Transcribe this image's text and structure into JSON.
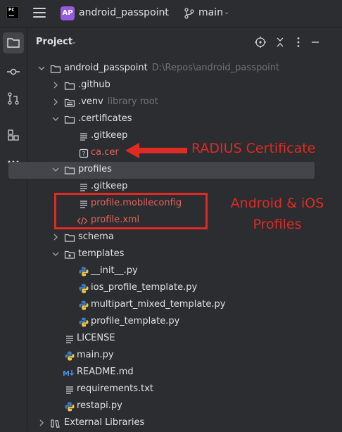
{
  "titlebar": {
    "logo_text": "PC",
    "project_badge": "AP",
    "project_name": "android_passpoint",
    "branch": "main"
  },
  "panel": {
    "title": "Project"
  },
  "tree": {
    "root": {
      "name": "android_passpoint",
      "path": "D:\\Repos\\android_passpoint"
    },
    "github": ".github",
    "venv": ".venv",
    "venv_hint": "library root",
    "certificates": ".certificates",
    "cert_gitkeep": ".gitkeep",
    "ca_cer": "ca.cer",
    "profiles": "profiles",
    "profiles_gitkeep": ".gitkeep",
    "mobileconfig": "profile.mobileconfig",
    "profile_xml": "profile.xml",
    "schema": "schema",
    "templates": "templates",
    "init_py": "__init__.py",
    "ios_template": "ios_profile_template.py",
    "multipart_template": "multipart_mixed_template.py",
    "profile_template": "profile_template.py",
    "license": "LICENSE",
    "main_py": "main.py",
    "readme": "README.md",
    "requirements": "requirements.txt",
    "restapi": "restapi.py",
    "external_libraries": "External Libraries"
  },
  "annotations": {
    "radius": "RADIUS Certificate",
    "android_line1": "Android & iOS",
    "android_line2": "Profiles",
    "color": "#e02a24"
  },
  "colors": {
    "background": "#2b2d30",
    "selection": "#43454a",
    "text": "#dfe1e5",
    "hint": "#6f737a",
    "vcs_modified_red": "#e3645a",
    "badge": "#955ae0"
  }
}
